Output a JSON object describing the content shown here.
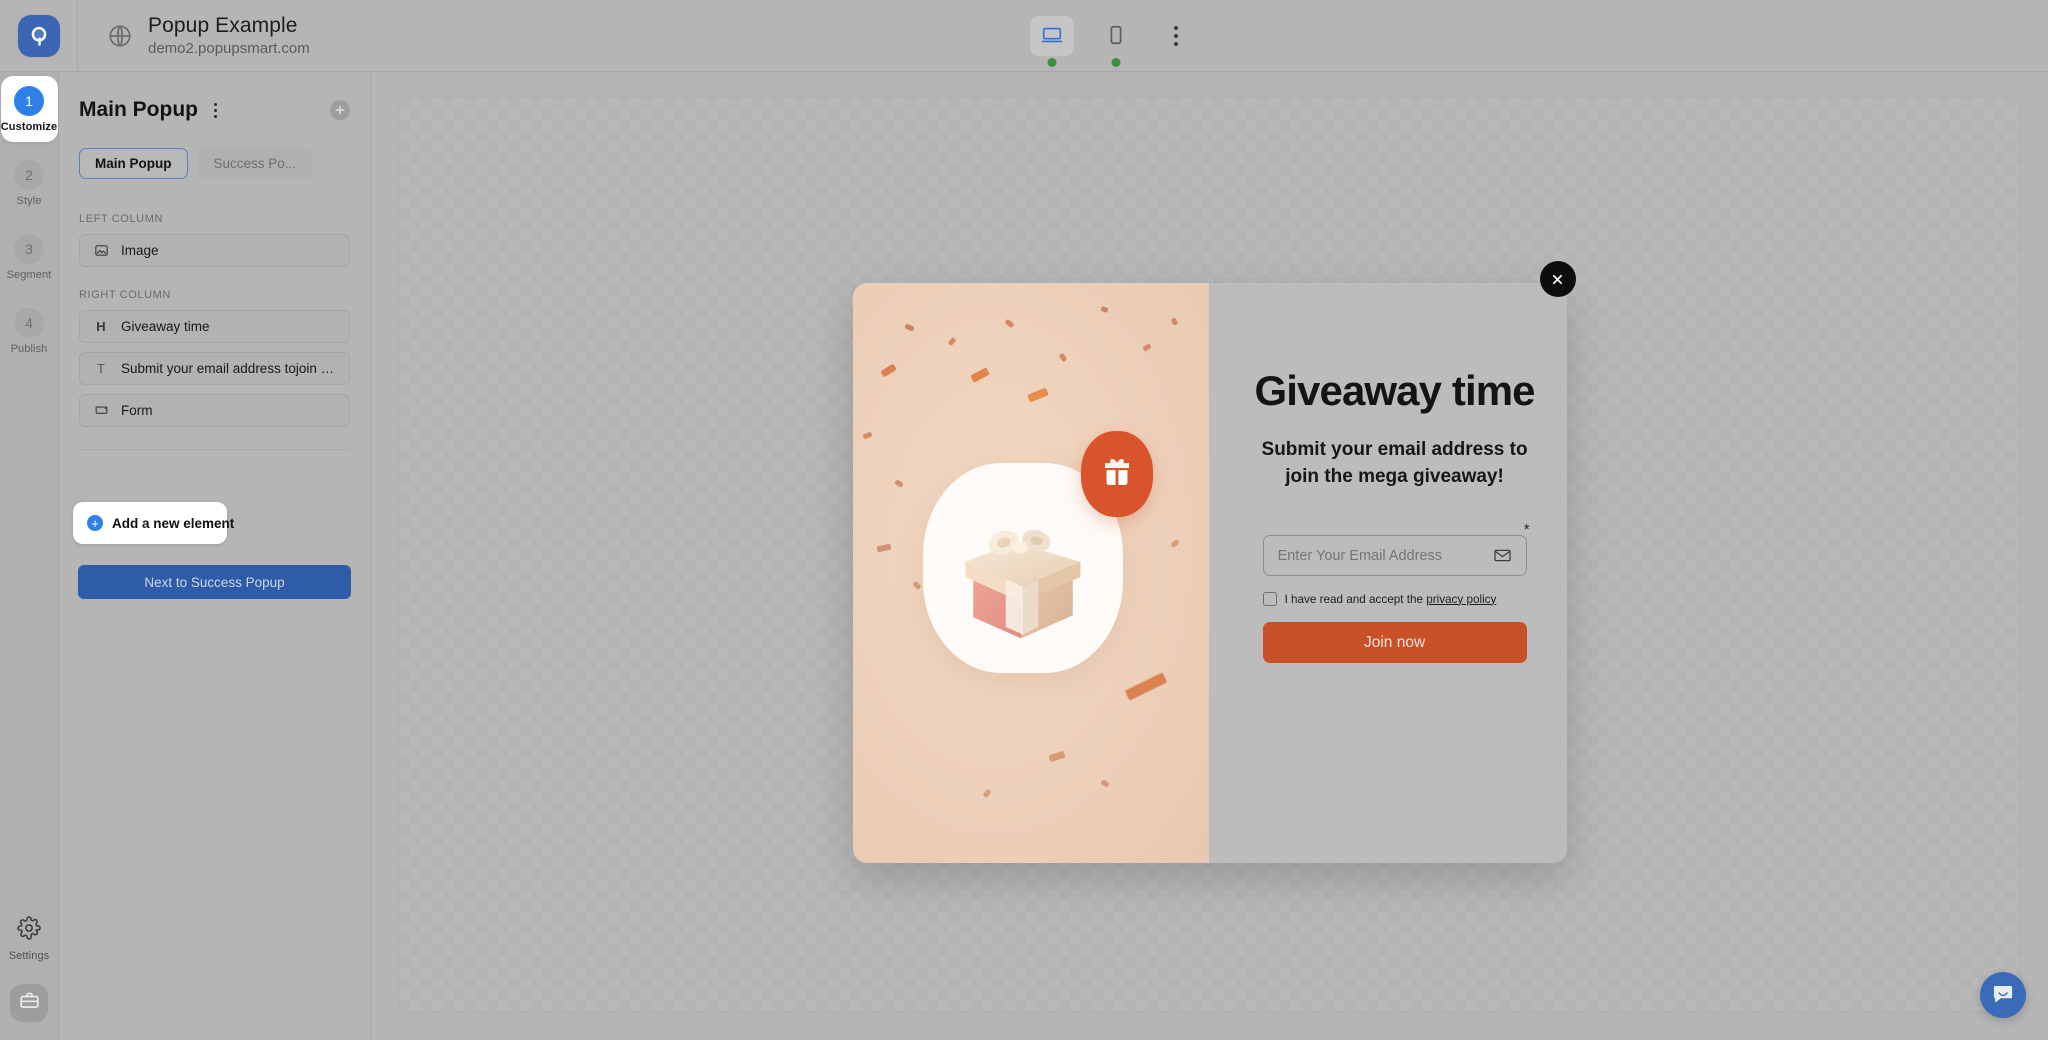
{
  "topbar": {
    "logo_icon": "popupsmart-logo",
    "globe_icon": "globe-icon",
    "site_title": "Popup Example",
    "site_url": "demo2.popupsmart.com",
    "desktop_icon": "desktop-icon",
    "mobile_icon": "mobile-icon",
    "more_icon": "kebab-menu-icon"
  },
  "rail": {
    "steps": [
      {
        "num": "1",
        "label": "Customize",
        "active": true
      },
      {
        "num": "2",
        "label": "Style",
        "active": false
      },
      {
        "num": "3",
        "label": "Segment",
        "active": false
      },
      {
        "num": "4",
        "label": "Publish",
        "active": false
      }
    ],
    "settings_label": "Settings",
    "settings_icon": "gear-icon",
    "case_icon": "briefcase-icon"
  },
  "panel": {
    "title": "Main Popup",
    "kebab_icon": "kebab-menu-icon",
    "add_icon": "plus-circle-icon",
    "tabs": [
      {
        "label": "Main Popup",
        "active": true
      },
      {
        "label": "Success Po...",
        "active": false
      }
    ],
    "groups": [
      {
        "label": "LEFT COLUMN",
        "items": [
          {
            "icon": "image-icon",
            "glyph": "image",
            "label": "Image"
          }
        ]
      },
      {
        "label": "RIGHT COLUMN",
        "items": [
          {
            "icon": "heading-icon",
            "glyph": "H",
            "label": "Giveaway time"
          },
          {
            "icon": "text-icon",
            "glyph": "T",
            "label": "Submit your email address tojoin th..."
          },
          {
            "icon": "form-icon",
            "glyph": "form",
            "label": "Form"
          }
        ]
      }
    ],
    "add_element_label": "Add a new element",
    "add_element_icon": "plus-circle-icon",
    "next_button_label": "Next to Success Popup"
  },
  "popup": {
    "close_icon": "close-icon",
    "gift_badge_icon": "gift-icon",
    "headline": "Giveaway time",
    "subheadline": "Submit your email address to join the mega giveaway!",
    "email_placeholder": "Enter Your Email Address",
    "email_value": "",
    "email_icon": "envelope-icon",
    "required_marker": "*",
    "consent_prefix": "I have read and accept the ",
    "consent_link": "privacy policy",
    "submit_label": "Join now"
  },
  "chat": {
    "icon": "chat-bubble-icon"
  },
  "colors": {
    "accent_blue": "#2f7fe8",
    "primary_button": "#2f5ca8",
    "popup_cta": "#c9512a",
    "gift_badge": "#d9542a",
    "status_dot": "#3f8f3f"
  }
}
